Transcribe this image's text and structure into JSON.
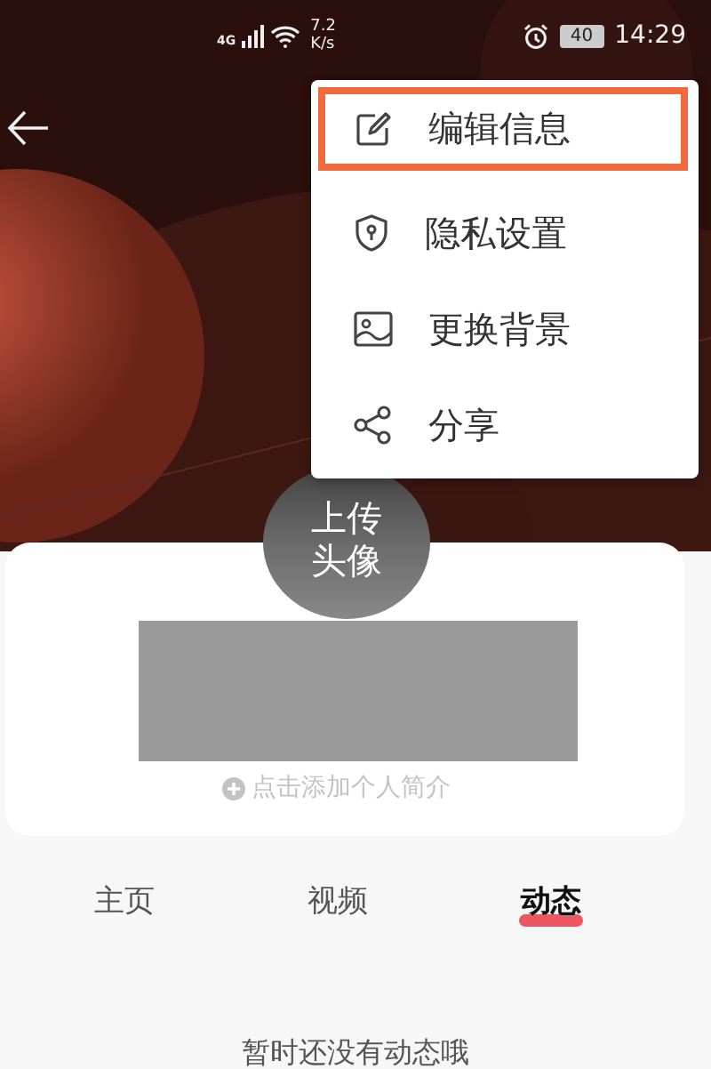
{
  "status_bar": {
    "network": "4G",
    "speed": "7.2",
    "speed_unit": "K/s",
    "battery": "40",
    "time": "14:29"
  },
  "menu": [
    {
      "kind": "edit",
      "label": "编辑信息",
      "highlighted": true
    },
    {
      "kind": "privacy",
      "label": "隐私设置",
      "highlighted": false
    },
    {
      "kind": "background",
      "label": "更换背景",
      "highlighted": false
    },
    {
      "kind": "share",
      "label": "分享",
      "highlighted": false
    }
  ],
  "avatar": {
    "label": "上传头像"
  },
  "profile": {
    "add_bio": "点击添加个人简介"
  },
  "tabs": [
    {
      "label": "主页",
      "selected": false
    },
    {
      "label": "视频",
      "selected": false
    },
    {
      "label": "动态",
      "selected": true
    }
  ],
  "empty_message": "暂时还没有动态哦"
}
